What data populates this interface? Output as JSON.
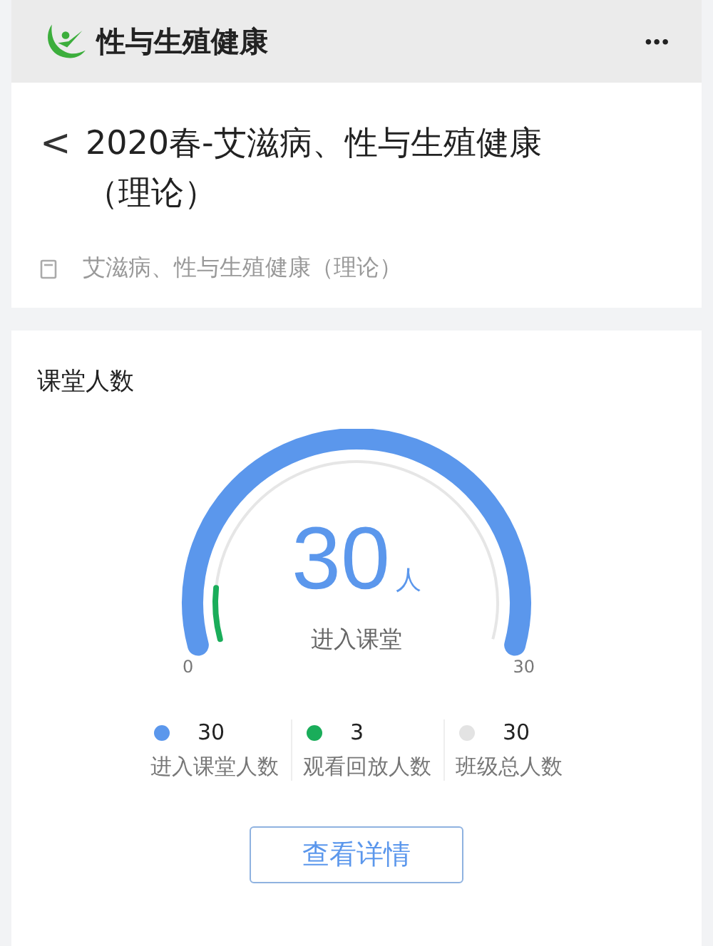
{
  "app_bar": {
    "title": "性与生殖健康",
    "menu": "•••"
  },
  "header": {
    "back": "<",
    "title": "2020春-艾滋病、性与生殖健康（理论）",
    "course": "艾滋病、性与生殖健康（理论）"
  },
  "attendance": {
    "title": "课堂人数",
    "gauge": {
      "value": "30",
      "unit": "人",
      "label": "进入课堂",
      "min": "0",
      "max": "30"
    },
    "legend": [
      {
        "value": "30",
        "label": "进入课堂人数",
        "color": "#5b97ec"
      },
      {
        "value": "3",
        "label": "观看回放人数",
        "color": "#1aad5a"
      },
      {
        "value": "30",
        "label": "班级总人数",
        "color": "#e3e3e3"
      }
    ],
    "button": "查看详情"
  }
}
